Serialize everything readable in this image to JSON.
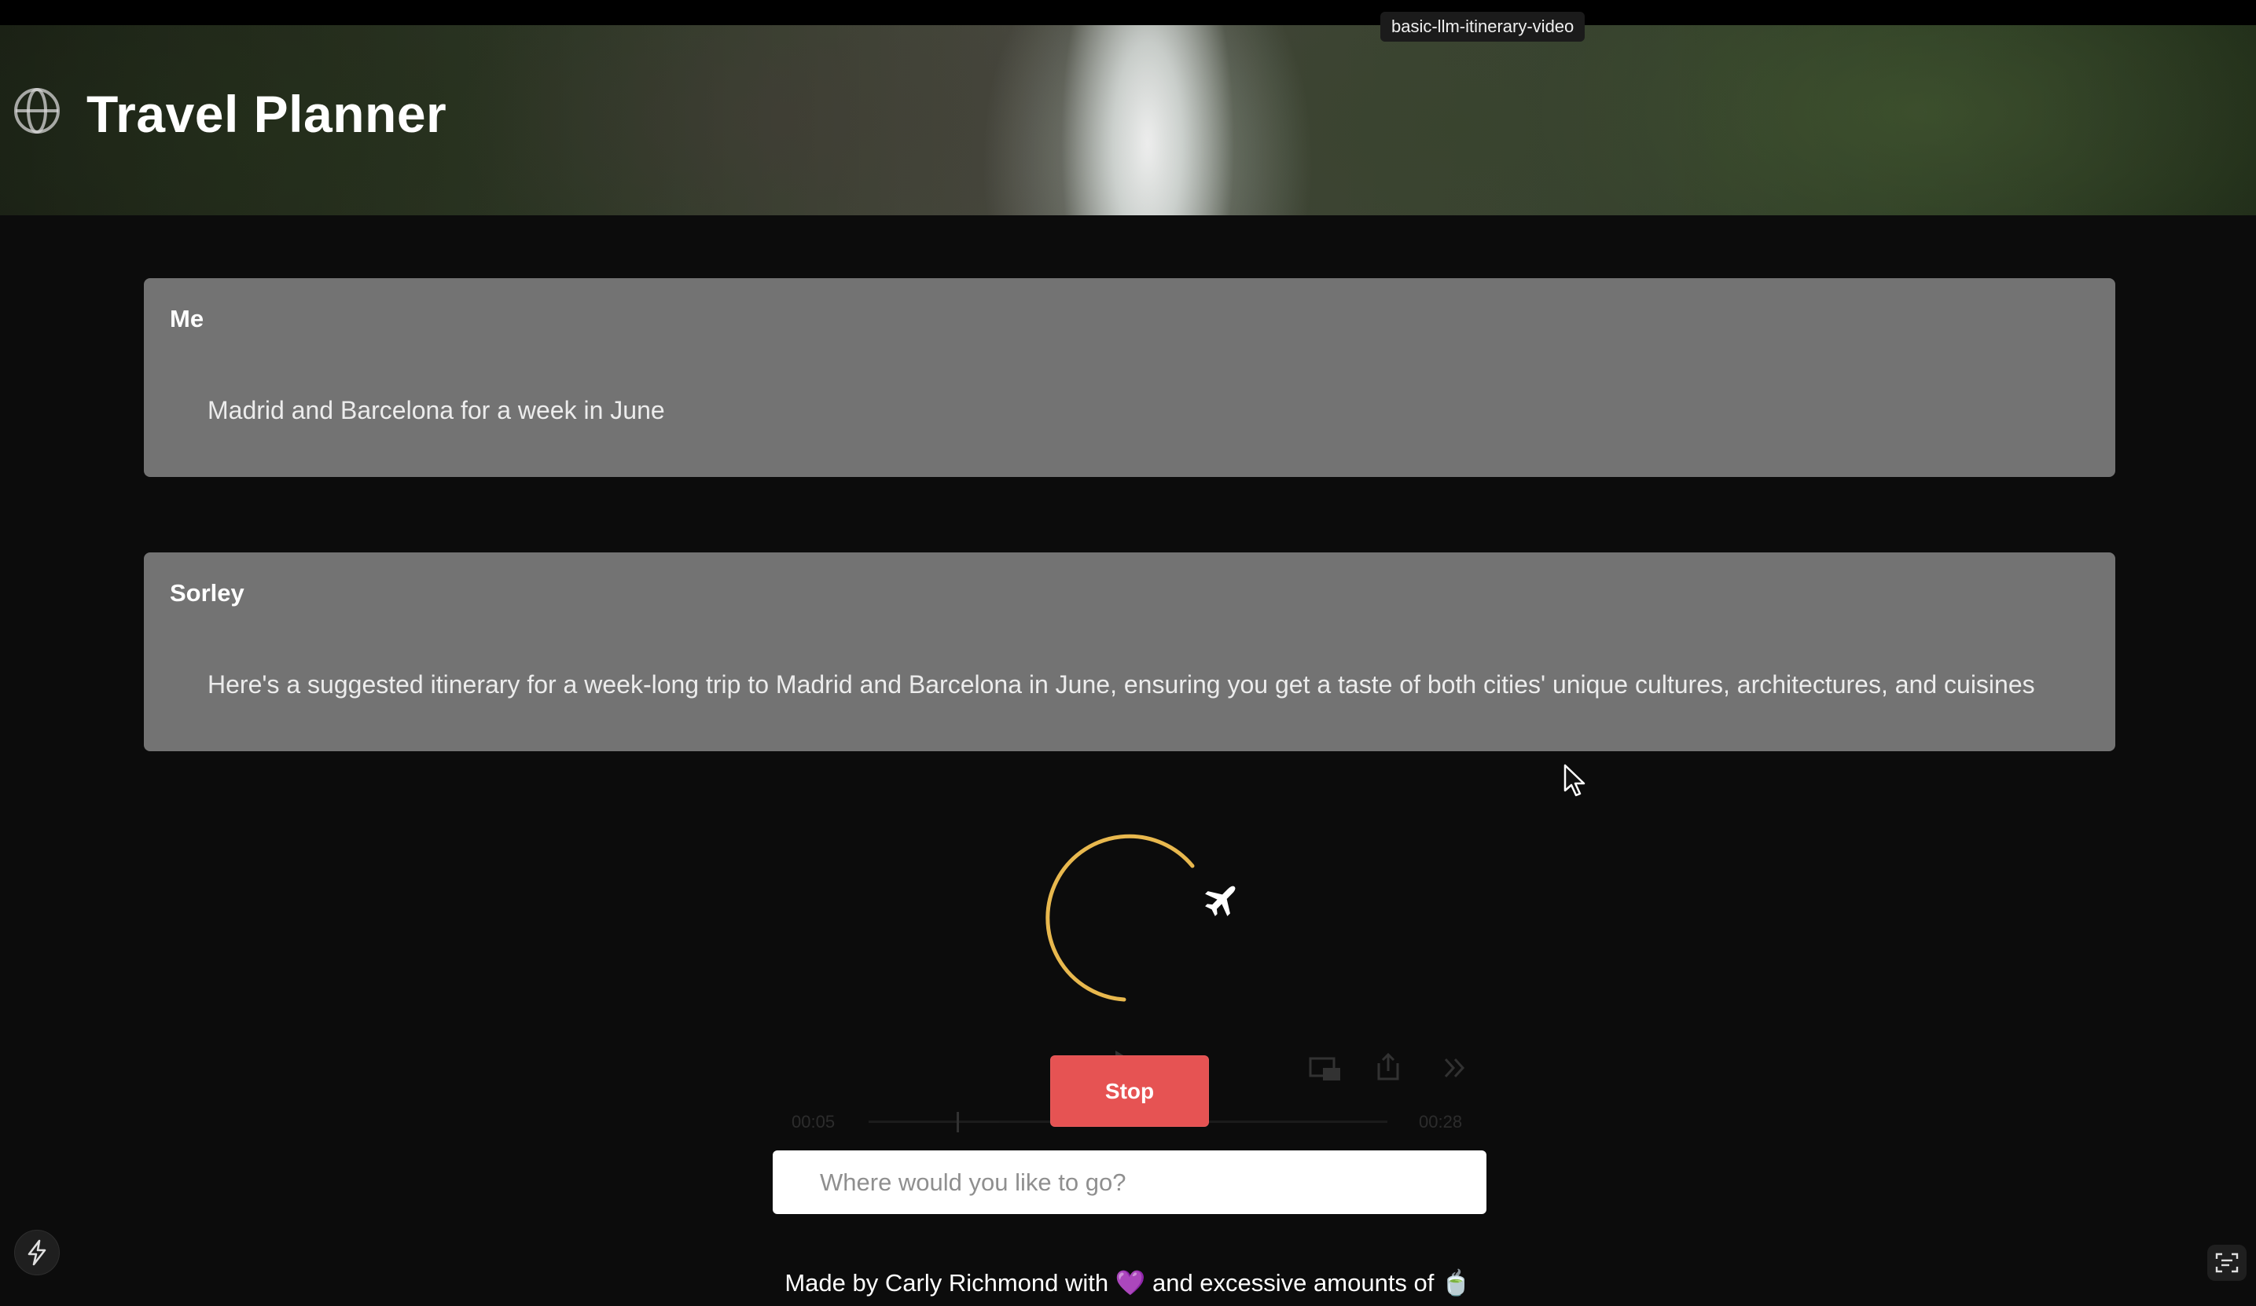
{
  "tooltip": {
    "text": "basic-llm-itinerary-video"
  },
  "header": {
    "title": "Travel Planner",
    "icon": "globe-icon"
  },
  "messages": [
    {
      "author": "Me",
      "text": "Madrid and Barcelona for a week in June"
    },
    {
      "author": "Sorley",
      "text": "Here's a suggested itinerary for a week-long trip to Madrid and Barcelona in June, ensuring you get a taste of both cities' unique cultures, architectures, and cuisines"
    }
  ],
  "loader": {
    "icon": "airplane-icon",
    "color": "#e8b84e"
  },
  "video_controls": {
    "current_time": "00:05",
    "total_time": "00:28"
  },
  "stop_button": {
    "label": "Stop",
    "color": "#e65353"
  },
  "search": {
    "placeholder": "Where would you like to go?",
    "value": ""
  },
  "footer": {
    "text_before": "Made by Carly Richmond with ",
    "heart": "💜",
    "text_after": " and excessive amounts of ",
    "tea": "🍵"
  }
}
